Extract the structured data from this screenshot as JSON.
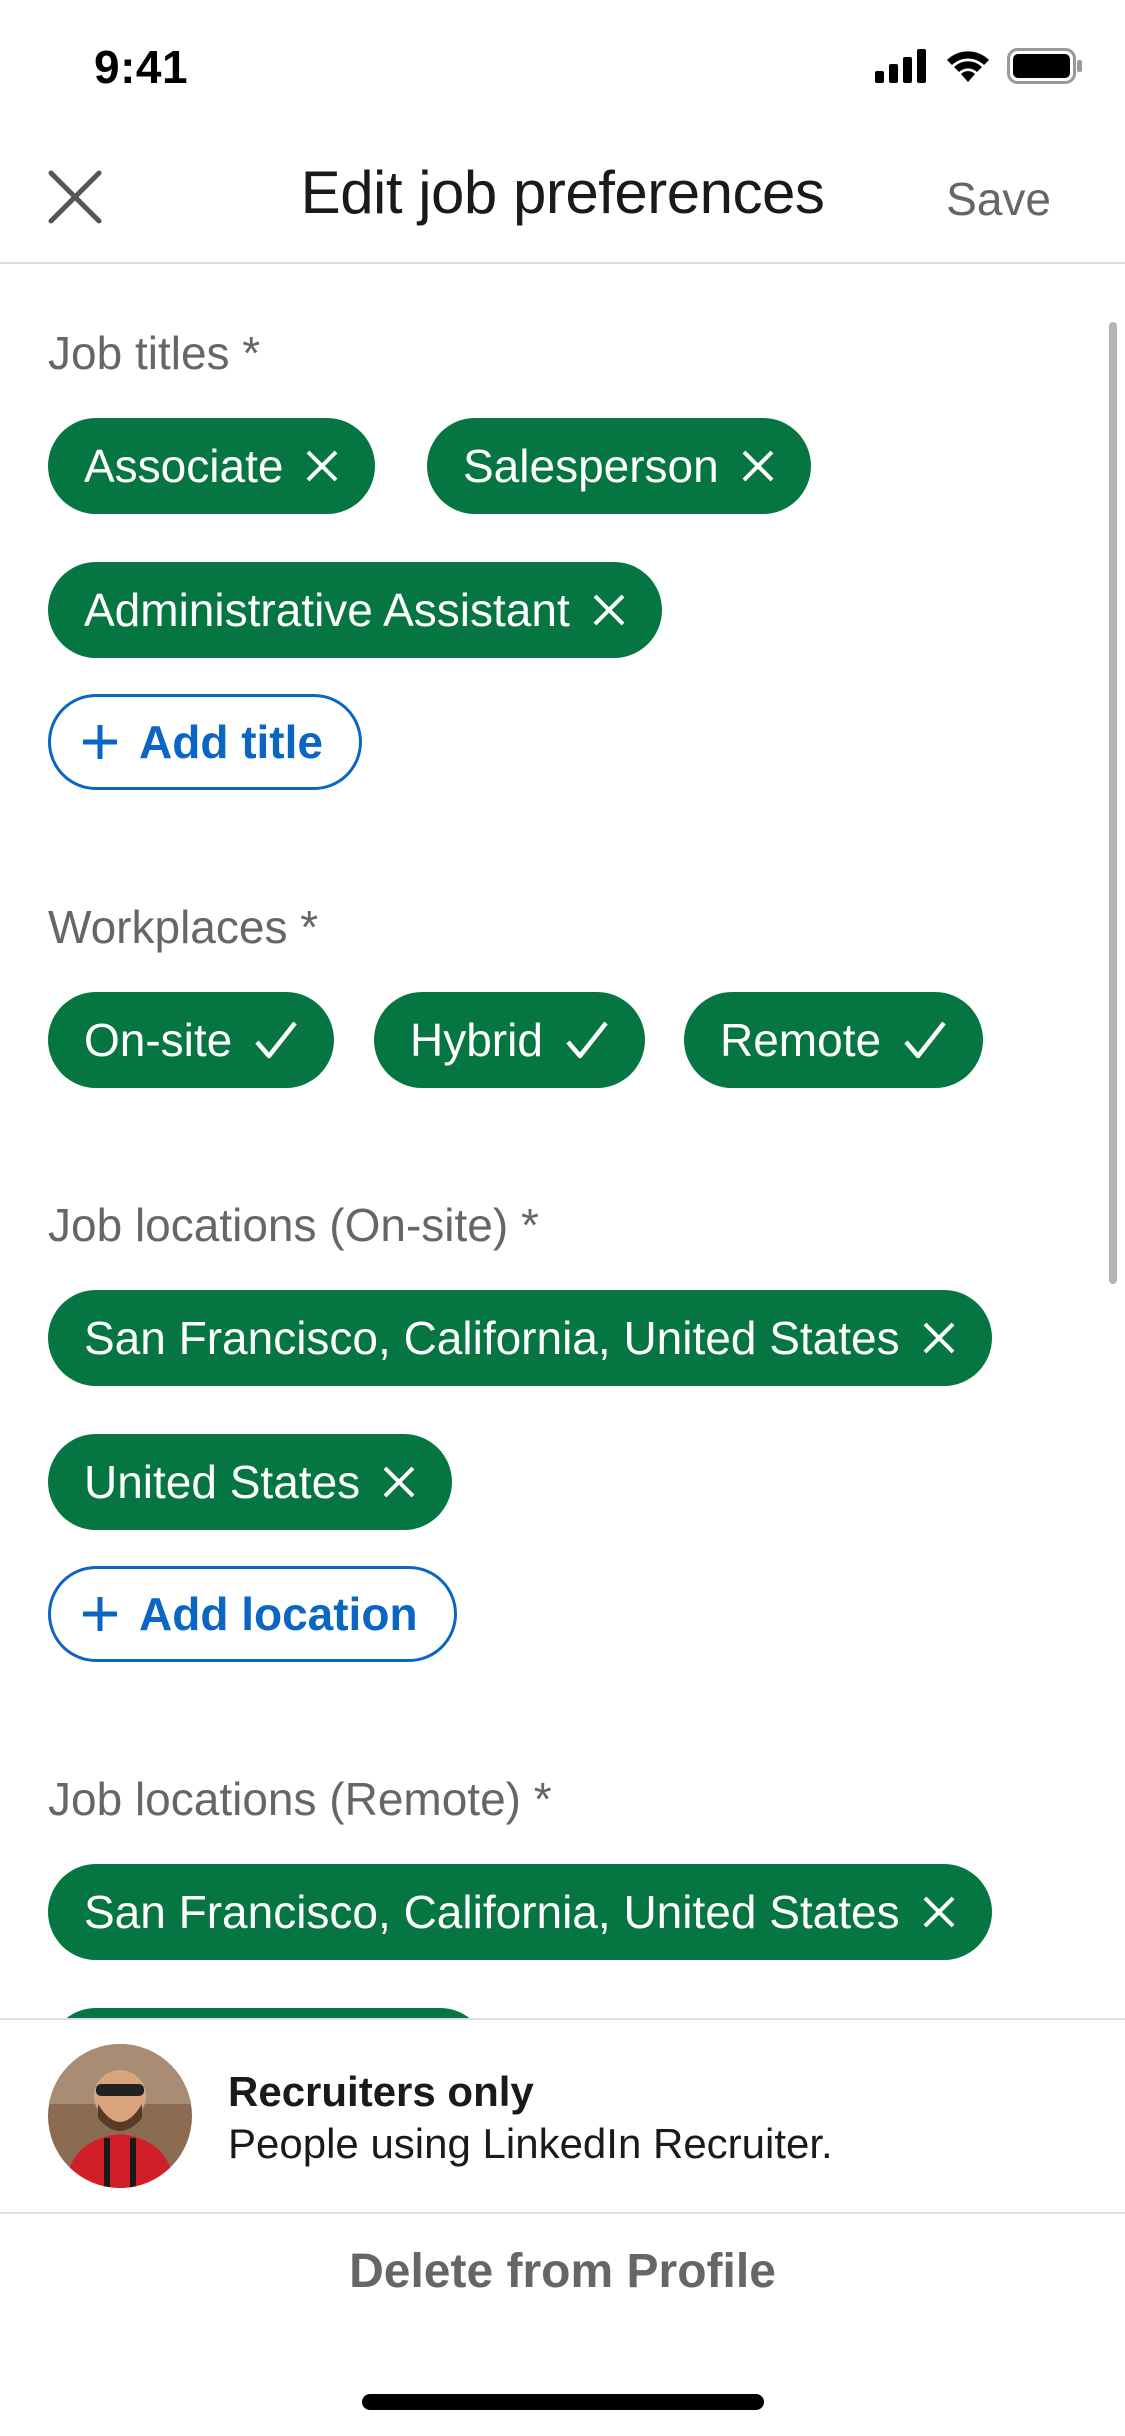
{
  "status_bar": {
    "time": "9:41"
  },
  "header": {
    "title": "Edit job preferences",
    "save_label": "Save"
  },
  "job_titles": {
    "label": "Job titles *",
    "chips": [
      "Associate",
      "Salesperson",
      "Administrative Assistant"
    ],
    "add_label": "Add title"
  },
  "workplaces": {
    "label": "Workplaces *",
    "chips": [
      "On-site",
      "Hybrid",
      "Remote"
    ]
  },
  "locations_onsite": {
    "label": "Job locations (On-site) *",
    "chips": [
      "San Francisco, California, United States",
      "United States"
    ],
    "add_label": "Add location"
  },
  "locations_remote": {
    "label": "Job locations (Remote) *",
    "chips": [
      "San Francisco, California, United States"
    ]
  },
  "visibility": {
    "title": "Recruiters only",
    "subtitle": "People using LinkedIn Recruiter."
  },
  "footer": {
    "delete_label": "Delete from Profile"
  },
  "colors": {
    "chip_green": "#057642",
    "link_blue": "#0a66c2",
    "muted_gray": "#666666"
  },
  "icons": [
    "close-icon",
    "remove-x-icon",
    "check-icon",
    "plus-icon",
    "signal-icon",
    "wifi-icon",
    "battery-icon"
  ]
}
